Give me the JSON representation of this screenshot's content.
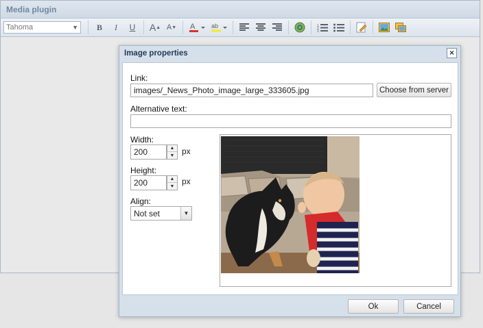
{
  "editor": {
    "title": "Media plugin",
    "font_select": "Tahoma",
    "toolbar": {
      "bold": "B",
      "italic": "I",
      "underline": "U",
      "font_grow": "A",
      "font_shrink": "A",
      "text_color": "A",
      "highlight": "ab"
    }
  },
  "dialog": {
    "title": "Image properties",
    "close": "×",
    "link_label": "Link:",
    "link_value": "images/_News_Photo_image_large_333605.jpg",
    "choose_button": "Choose from server",
    "alt_label": "Alternative text:",
    "alt_value": "",
    "width_label": "Width:",
    "width_value": "200",
    "height_label": "Height:",
    "height_value": "200",
    "unit": "px",
    "align_label": "Align:",
    "align_value": "Not set",
    "ok_button": "Ok",
    "cancel_button": "Cancel"
  },
  "colors": {
    "accent": "#243a5a",
    "text_color_bar": "#d9342b",
    "highlight_bar": "#f2e94e"
  }
}
